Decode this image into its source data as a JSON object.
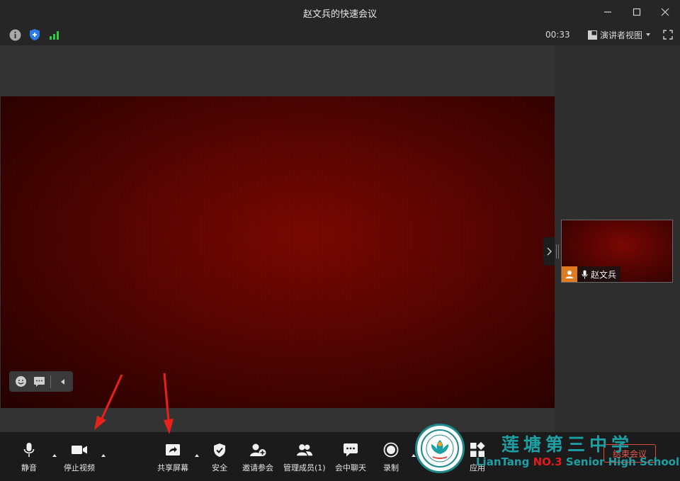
{
  "window": {
    "title": "赵文兵的快速会议"
  },
  "infobar": {
    "timer": "00:33",
    "speaker_view_label": "演讲者视图"
  },
  "participants": [
    {
      "name": "赵文兵"
    }
  ],
  "toolbar": {
    "mute_label": "静音",
    "stop_video_label": "停止视频",
    "share_screen_label": "共享屏幕",
    "security_label": "安全",
    "invite_label": "邀请参会",
    "manage_members_label": "管理成员(1)",
    "chat_label": "会中聊天",
    "record_label": "录制",
    "apps_label": "应用",
    "end_meeting_label": "结束会议"
  },
  "watermark": {
    "school_name_cn": "莲塘第三中学",
    "school_name_en_prefix": "LianTang ",
    "school_name_en_no": "NO.3",
    "school_name_en_suffix": " Senior High School"
  },
  "colors": {
    "accent_signal": "#2ecc40",
    "shield_blue": "#2f7be5",
    "avatar_orange": "#e07a1f",
    "end_red": "#e0483d",
    "watermark_teal": "#1e9fa3"
  }
}
